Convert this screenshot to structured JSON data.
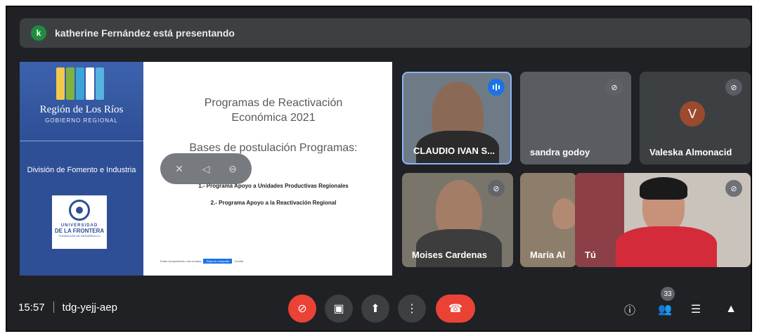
{
  "presenter_banner": {
    "initial": "k",
    "text": "katherine Fernández está presentando"
  },
  "slide": {
    "region_name": "Región de Los Ríos",
    "gobierno": "GOBIERNO REGIONAL",
    "division": "División de Fomento e Industria",
    "ufro_line1": "UNIVERSIDAD",
    "ufro_line2": "DE LA FRONTERA",
    "ufro_line3": "FUNDACIÓN DE DESARROLLO",
    "title_line1": "Programas de Reactivación",
    "title_line2": "Económica 2021",
    "subtitle": "Bases de postulación Programas:",
    "program1": "1.- Programa Apoyo a Unidades Productivas Regionales",
    "program2": "2.- Programa Apoyo a la Reactivación Regional",
    "share_bar_text": "Estás compartiendo una ventana",
    "share_bar_button": "Dejar de compartir",
    "share_bar_hide": "Ocultar"
  },
  "participants": [
    {
      "name": "CLAUDIO IVAN S...",
      "speaking": true
    },
    {
      "name": "sandra godoy",
      "muted": true
    },
    {
      "name": "Valeska Almonacid",
      "initial": "V",
      "muted": true
    },
    {
      "name": "Moises Cardenas",
      "muted": true
    },
    {
      "name": "María Al",
      "muted": false
    },
    {
      "name": "Tú",
      "muted": true
    }
  ],
  "meeting": {
    "time": "15:57",
    "code": "tdg-yejj-aep",
    "participant_count": "33"
  },
  "colors": {
    "end_call": "#ea4335",
    "mic_off": "#ea4335",
    "toolbar_bg": "#202124",
    "accent": "#1a73e8"
  },
  "icons": [
    "mic-off-icon",
    "camera-icon",
    "present-icon",
    "more-icon",
    "end-call-icon",
    "info-icon",
    "people-icon",
    "chat-icon",
    "activities-icon"
  ]
}
